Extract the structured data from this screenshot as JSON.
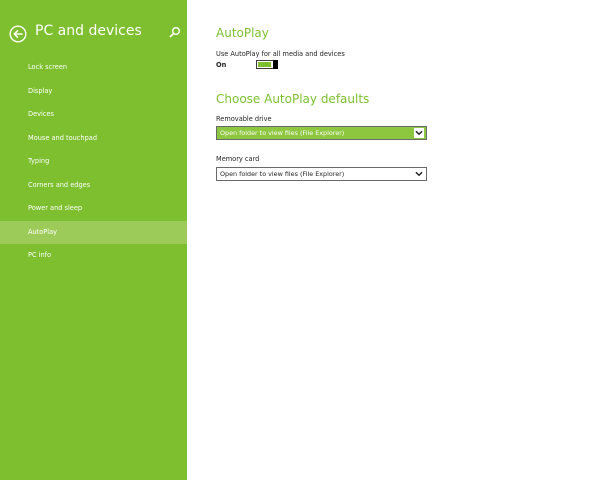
{
  "sidebar": {
    "title": "PC and devices",
    "items": [
      {
        "label": "Lock screen",
        "active": false
      },
      {
        "label": "Display",
        "active": false
      },
      {
        "label": "Devices",
        "active": false
      },
      {
        "label": "Mouse and touchpad",
        "active": false
      },
      {
        "label": "Typing",
        "active": false
      },
      {
        "label": "Corners and edges",
        "active": false
      },
      {
        "label": "Power and sleep",
        "active": false
      },
      {
        "label": "AutoPlay",
        "active": true
      },
      {
        "label": "PC info",
        "active": false
      }
    ]
  },
  "main": {
    "title": "AutoPlay",
    "autoplay_toggle": {
      "label": "Use AutoPlay for all media and devices",
      "state": "On"
    },
    "defaults_title": "Choose AutoPlay defaults",
    "removable_drive": {
      "label": "Removable drive",
      "value": "Open folder to view files (File Explorer)"
    },
    "memory_card": {
      "label": "Memory card",
      "value": "Open folder to view files (File Explorer)"
    }
  },
  "colors": {
    "sidebar_bg": "#7dbf2e",
    "active_item_bg": "#9ccb5a",
    "accent": "#7dbf2e",
    "highlight_select": "#8dc63f"
  },
  "icons": {
    "back": "back-arrow-circle-icon",
    "search": "search-icon",
    "dropdown": "chevron-down-icon"
  }
}
